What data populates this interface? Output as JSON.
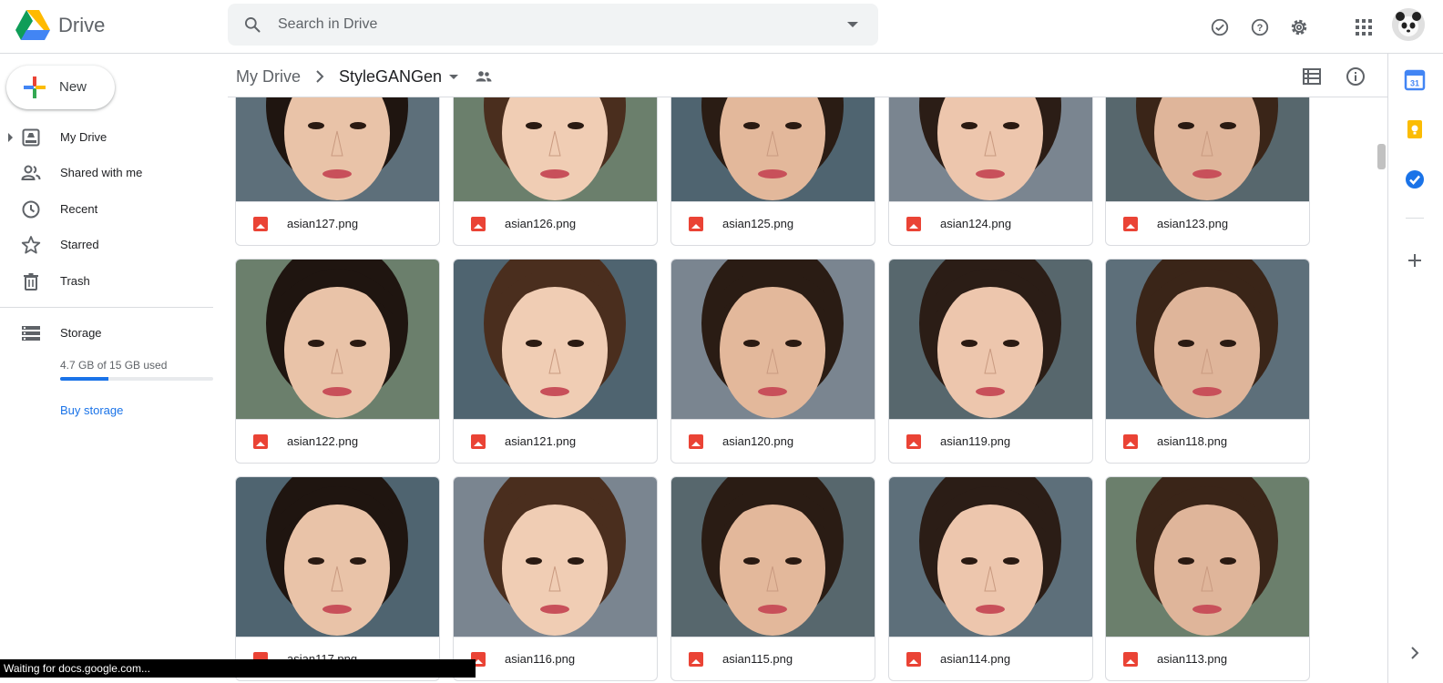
{
  "app": {
    "name": "Drive",
    "logo_icon": "google-drive-logo"
  },
  "search": {
    "placeholder": "Search in Drive",
    "value": ""
  },
  "header_icons": [
    "offline-ready-icon",
    "help-icon",
    "settings-icon",
    "apps-grid-icon"
  ],
  "sidebar": {
    "new_label": "New",
    "items": [
      {
        "label": "My Drive",
        "icon": "my-drive-icon"
      },
      {
        "label": "Shared with me",
        "icon": "shared-people-icon"
      },
      {
        "label": "Recent",
        "icon": "clock-icon"
      },
      {
        "label": "Starred",
        "icon": "star-icon"
      },
      {
        "label": "Trash",
        "icon": "trash-icon"
      }
    ],
    "storage": {
      "label": "Storage",
      "used_text": "4.7 GB of 15 GB used",
      "used_fraction": 0.313,
      "buy_label": "Buy storage"
    }
  },
  "breadcrumb": {
    "root": "My Drive",
    "current": "StyleGANGen"
  },
  "files": [
    {
      "name": "asian127.png"
    },
    {
      "name": "asian126.png"
    },
    {
      "name": "asian125.png"
    },
    {
      "name": "asian124.png"
    },
    {
      "name": "asian123.png"
    },
    {
      "name": "asian122.png"
    },
    {
      "name": "asian121.png"
    },
    {
      "name": "asian120.png"
    },
    {
      "name": "asian119.png"
    },
    {
      "name": "asian118.png"
    },
    {
      "name": "asian117.png"
    },
    {
      "name": "asian116.png"
    },
    {
      "name": "asian115.png"
    },
    {
      "name": "asian114.png"
    },
    {
      "name": "asian113.png"
    }
  ],
  "right_panel_icons": [
    "calendar-icon",
    "keep-icon",
    "tasks-icon",
    "add-addon-icon"
  ],
  "status_text": "Waiting for docs.google.com...",
  "colors": {
    "accent": "#1a73e8",
    "image_file_icon": "#ea4335"
  }
}
